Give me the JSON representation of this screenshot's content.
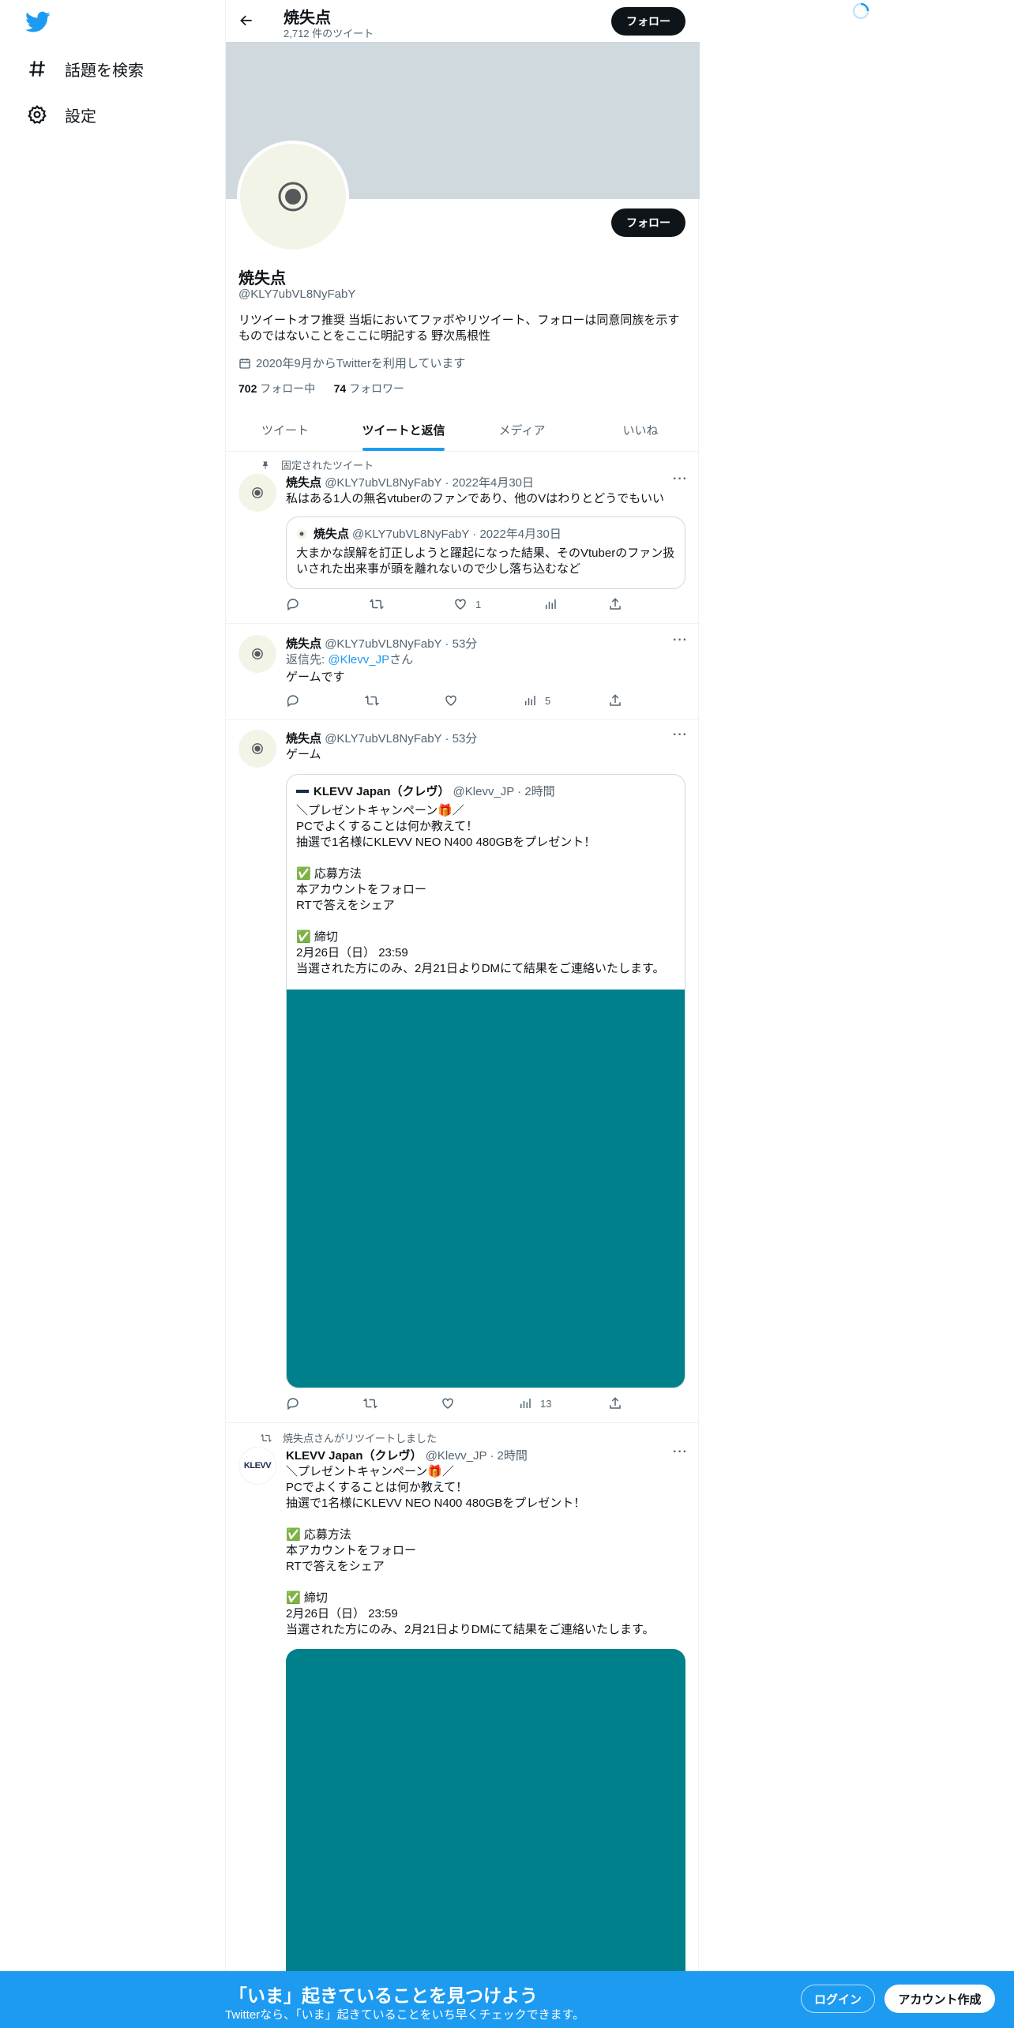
{
  "sidebar": {
    "logo": "twitter-bird-icon",
    "items": [
      {
        "label": "話題を検索",
        "icon": "hashtag-icon"
      },
      {
        "label": "設定",
        "icon": "gear-icon"
      }
    ]
  },
  "header": {
    "title": "焼失点",
    "tweet_count": "2,712 件のツイート",
    "follow_label": "フォロー"
  },
  "profile": {
    "name": "焼失点",
    "handle": "@KLY7ubVL8NyFabY",
    "bio": "リツイートオフ推奨 当垢においてファボやリツイート、フォローは同意同族を示すものではないことをここに明記する 野次馬根性",
    "joined": "2020年9月からTwitterを利用しています",
    "following_count": "702",
    "following_label": "フォロー中",
    "followers_count": "74",
    "followers_label": "フォロワー",
    "follow_label": "フォロー"
  },
  "tabs": [
    {
      "label": "ツイート",
      "active": false
    },
    {
      "label": "ツイートと返信",
      "active": true
    },
    {
      "label": "メディア",
      "active": false
    },
    {
      "label": "いいね",
      "active": false
    }
  ],
  "tweets": [
    {
      "social_context": "固定されたツイート",
      "name": "焼失点",
      "handle": "@KLY7ubVL8NyFabY · 2022年4月30日",
      "text": "私はある1人の無名vtuberのファンであり、他のVはわりとどうでもいい",
      "quote": {
        "name": "焼失点",
        "handle": "@KLY7ubVL8NyFabY · 2022年4月30日",
        "text": "大まかな誤解を訂正しようと躍起になった結果、そのVtuberのファン扱いされた出来事が頭を離れないので少し落ち込むなど"
      },
      "likes": "1",
      "views": ""
    },
    {
      "name": "焼失点",
      "handle": "@KLY7ubVL8NyFabY · 53分",
      "reply_prefix": "返信先: ",
      "reply_to": "@Klevv_JP",
      "reply_suffix": "さん",
      "text": "ゲームです",
      "likes": "",
      "views": "5"
    },
    {
      "name": "焼失点",
      "handle": "@KLY7ubVL8NyFabY · 53分",
      "text": "ゲーム",
      "quote": {
        "name": "KLEVV Japan（クレヴ）",
        "handle": "@Klevv_JP · 2時間",
        "text": "＼プレゼントキャンペーン🎁／\nPCでよくすることは何か教えて！\n抽選で1名様にKLEVV NEO N400 480GBをプレゼント！\n\n✅ 応募方法\n本アカウントをフォロー\nRTで答えをシェア\n\n✅ 締切\n2月26日（日） 23:59\n当選された方にのみ、2月21日よりDMにて結果をご連絡いたします。"
      },
      "likes": "",
      "views": "13"
    },
    {
      "social_context": "焼失点さんがリツイートしました",
      "name": "KLEVV Japan（クレヴ）",
      "handle": "@Klevv_JP · 2時間",
      "avatar_text": "KLEVV",
      "text": "＼プレゼントキャンペーン🎁／\nPCでよくすることは何か教えて！\n抽選で1名様にKLEVV NEO N400 480GBをプレゼント！\n\n✅ 応募方法\n本アカウントをフォロー\nRTで答えをシェア\n\n✅ 締切\n2月26日（日） 23:59\n当選された方にのみ、2月21日よりDMにて結果をご連絡いたします。"
    }
  ],
  "media_color": "#00808b",
  "bottom_bar": {
    "title": "「いま」起きていることを見つけよう",
    "subtitle": "Twitterなら、「いま」起きていることをいち早くチェックできます。",
    "login_label": "ログイン",
    "signup_label": "アカウント作成",
    "color": "#1d9bf0"
  }
}
